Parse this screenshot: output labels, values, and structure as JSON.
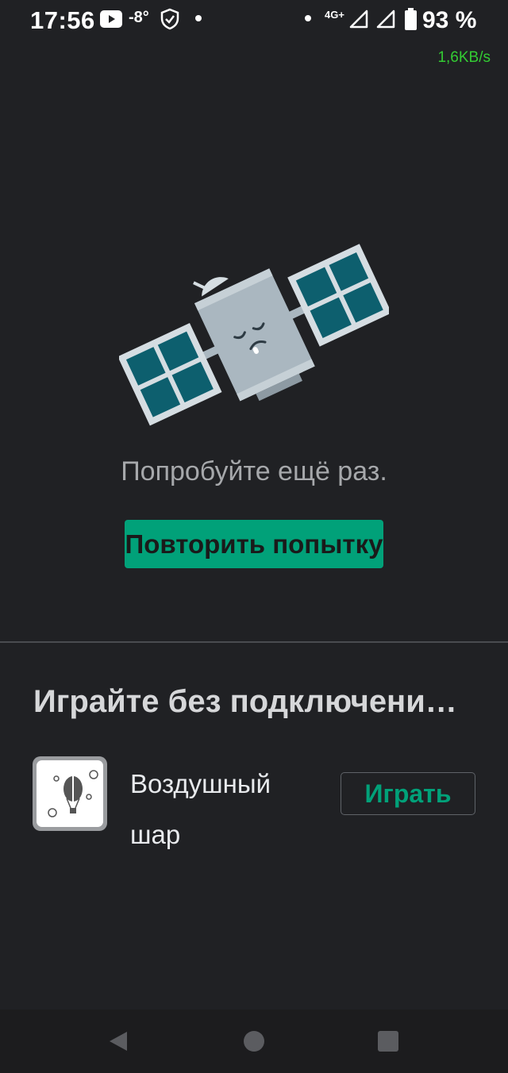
{
  "status_bar": {
    "time": "17:56",
    "temperature": "-8°",
    "network_type": "4G+",
    "battery_percent": "93 %",
    "net_speed": "1,6KB/s",
    "icons": [
      "youtube-icon",
      "shield-check-icon",
      "notification-dot-icon",
      "signal-icon",
      "battery-icon"
    ]
  },
  "error": {
    "illustration": "sleeping-satellite-illustration",
    "message": "Попробуйте ещё раз.",
    "retry_label": "Повторить попытку"
  },
  "offline_games": {
    "title": "Играйте без подключени…",
    "games": [
      {
        "name": "Воздушный шар",
        "icon": "hot-air-balloon-icon",
        "play_label": "Играть"
      }
    ]
  },
  "nav_bar": {
    "icons": [
      "back-icon",
      "home-icon",
      "recents-icon"
    ]
  },
  "colors": {
    "background": "#202124",
    "accent": "#01a179",
    "speed_text": "#33cc33",
    "panel": "#0d5f6e",
    "satellite_body": "#aab7c0"
  }
}
